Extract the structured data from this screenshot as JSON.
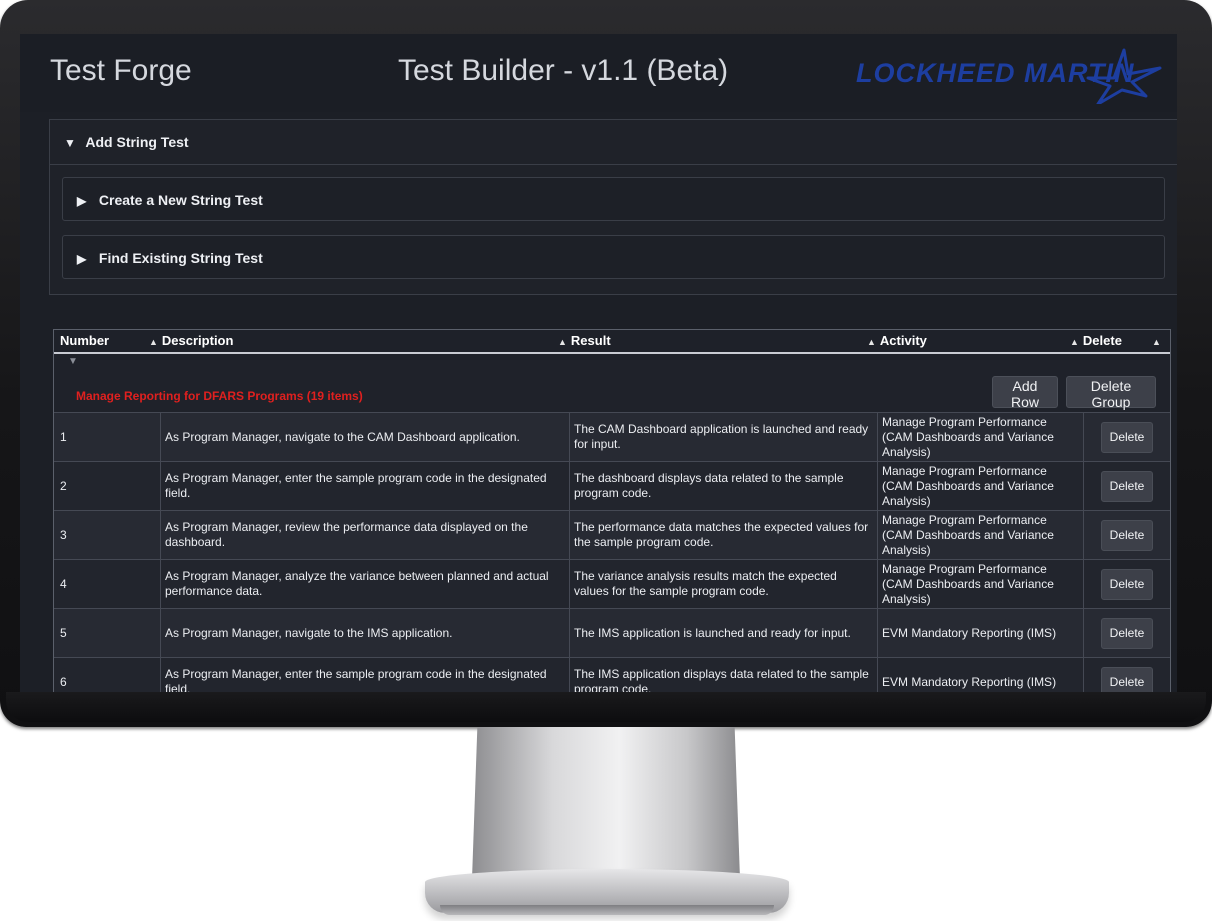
{
  "header": {
    "brand": "Test Forge",
    "title": "Test Builder - v1.1 (Beta)",
    "logo_text": "LOCKHEED MARTIN"
  },
  "accordion": {
    "main_label": "Add String Test",
    "panels": [
      {
        "label": "Create a New String Test"
      },
      {
        "label": "Find Existing String Test"
      }
    ]
  },
  "grid": {
    "columns": {
      "number": "Number",
      "description": "Description",
      "result": "Result",
      "activity": "Activity",
      "delete": "Delete"
    },
    "group": {
      "label": "Manage Reporting for DFARS Programs (19 items)",
      "add_row": "Add Row",
      "delete_group": "Delete Group"
    },
    "delete_label": "Delete",
    "rows": [
      {
        "number": "1",
        "description": "As Program Manager, navigate to the CAM Dashboard application.",
        "result": "The CAM Dashboard application is launched and ready for input.",
        "activity": "Manage Program Performance (CAM Dashboards and Variance Analysis)"
      },
      {
        "number": "2",
        "description": "As Program Manager, enter the sample program code in the designated field.",
        "result": "The dashboard displays data related to the sample program code.",
        "activity": "Manage Program Performance (CAM Dashboards and Variance Analysis)"
      },
      {
        "number": "3",
        "description": "As Program Manager, review the performance data displayed on the dashboard.",
        "result": "The performance data matches the expected values for the sample program code.",
        "activity": "Manage Program Performance (CAM Dashboards and Variance Analysis)"
      },
      {
        "number": "4",
        "description": "As Program Manager, analyze the variance between planned and actual performance data.",
        "result": "The variance analysis results match the expected values for the sample program code.",
        "activity": "Manage Program Performance (CAM Dashboards and Variance Analysis)"
      },
      {
        "number": "5",
        "description": "As Program Manager, navigate to the IMS application.",
        "result": "The IMS application is launched and ready for input.",
        "activity": "EVM Mandatory Reporting (IMS)"
      },
      {
        "number": "6",
        "description": "As Program Manager, enter the sample program code in the designated field.",
        "result": "The IMS application displays data related to the sample program code.",
        "activity": "EVM Mandatory Reporting (IMS)"
      }
    ]
  },
  "colors": {
    "screen_bg": "#1c1f26",
    "group_label": "#e0201f",
    "logo": "#1d3ea0"
  }
}
